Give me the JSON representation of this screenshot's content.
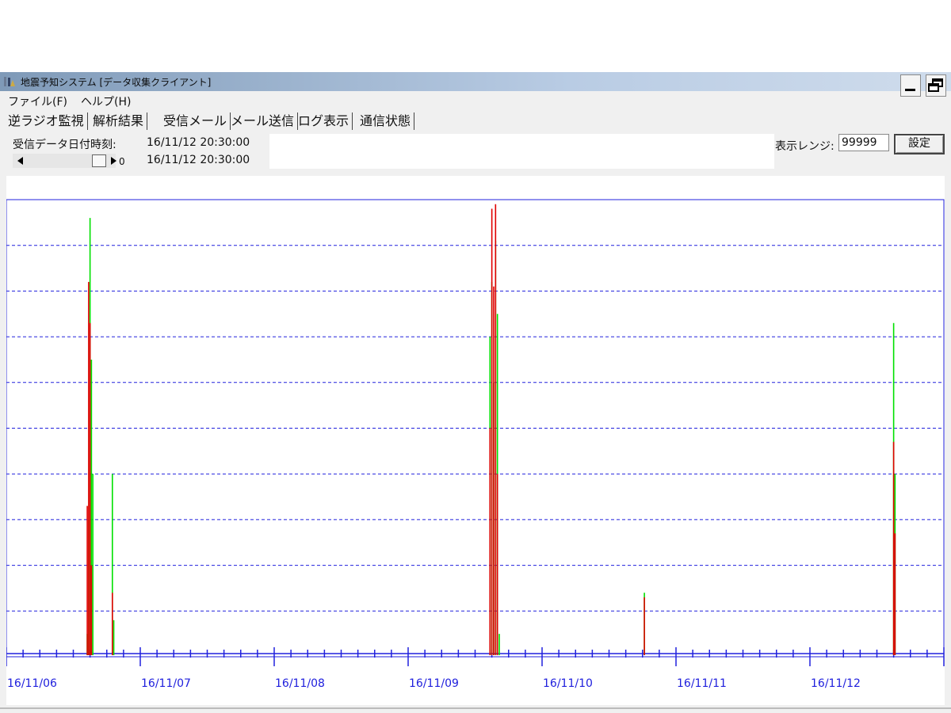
{
  "window": {
    "title": "地震予知システム [データ収集クライアント]"
  },
  "menu": [
    {
      "label": "ファイル(F)"
    },
    {
      "label": "ヘルプ(H)"
    }
  ],
  "tabs": [
    {
      "label": "逆ラジオ監視"
    },
    {
      "label": "解析結果"
    },
    {
      "label": "受信メール"
    },
    {
      "label": "メール送信"
    },
    {
      "label": "ログ表示"
    },
    {
      "label": "通信状態"
    }
  ],
  "panel": {
    "received_label": "受信データ日付時刻:",
    "received_value": "16/11/12 20:30:00",
    "slider_value": "0",
    "slider_datetime": "16/11/12 20:30:00",
    "range_label": "表示レンジ:",
    "range_value": "99999",
    "set_button": "設定"
  },
  "colors": {
    "axis": "#2020dd",
    "series_green": "#00e000",
    "series_red": "#e00000"
  },
  "chart_data": {
    "type": "bar",
    "x_tick_labels": [
      "16/11/06",
      "16/11/07",
      "16/11/08",
      "16/11/09",
      "16/11/10",
      "16/11/11",
      "16/11/12"
    ],
    "xlim": [
      "16/11/06 00:00",
      "16/11/13 00:00"
    ],
    "ylim": [
      0,
      1
    ],
    "y_gridlines": 10,
    "y_tick_labels": [],
    "series": [
      {
        "color": "green",
        "x": [
          "16/11/06 14:30",
          "16/11/06 14:45",
          "16/11/06 15:00",
          "16/11/06 15:15",
          "16/11/06 15:30",
          "16/11/06 19:00",
          "16/11/06 19:15",
          "16/11/09 14:40",
          "16/11/09 15:00",
          "16/11/09 15:20",
          "16/11/09 15:40",
          "16/11/09 16:00",
          "16/11/09 16:20",
          "16/11/10 18:20",
          "16/11/12 15:00",
          "16/11/12 15:15"
        ],
        "values": [
          0.05,
          0.3,
          0.96,
          0.65,
          0.4,
          0.4,
          0.08,
          0.7,
          0.82,
          0.6,
          0.91,
          0.75,
          0.05,
          0.14,
          0.73,
          0.4
        ]
      },
      {
        "color": "red",
        "x": [
          "16/11/06 14:30",
          "16/11/06 14:45",
          "16/11/06 15:00",
          "16/11/06 15:15",
          "16/11/06 19:00",
          "16/11/09 14:40",
          "16/11/09 15:00",
          "16/11/09 15:20",
          "16/11/09 15:40",
          "16/11/09 16:00",
          "16/11/10 18:20",
          "16/11/12 15:00",
          "16/11/12 15:15"
        ],
        "values": [
          0.33,
          0.82,
          0.73,
          0.2,
          0.14,
          0.5,
          0.98,
          0.81,
          0.99,
          0.4,
          0.13,
          0.47,
          0.27
        ]
      }
    ]
  }
}
